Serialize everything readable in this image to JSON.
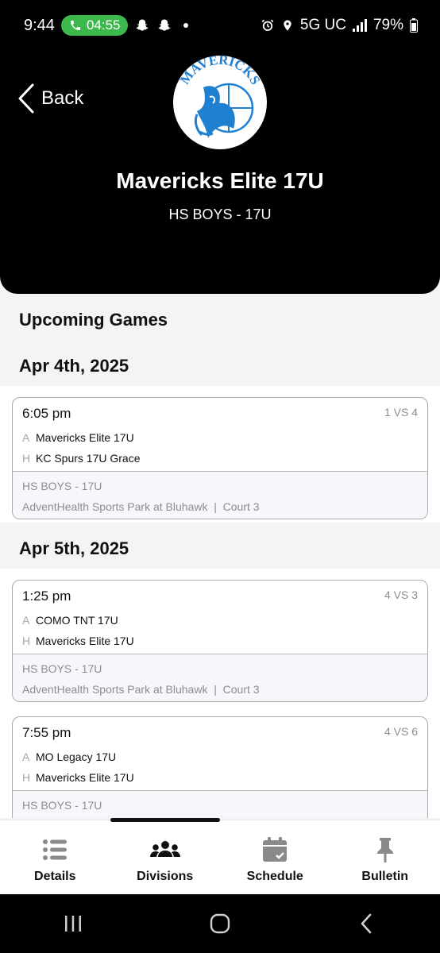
{
  "status_bar": {
    "time": "9:44",
    "call_timer": "04:55",
    "network": "5G UC",
    "battery": "79%"
  },
  "header": {
    "back_label": "Back",
    "logo_text": "MAVERICKS",
    "team_name": "Mavericks Elite 17U",
    "division": "HS BOYS - 17U"
  },
  "main": {
    "section_title": "Upcoming Games",
    "dates": [
      {
        "label": "Apr 4th, 2025"
      },
      {
        "label": "Apr 5th, 2025"
      }
    ],
    "games": [
      {
        "time": "6:05 pm",
        "matchup": "1 VS 4",
        "away_tag": "A",
        "away_team": "Mavericks Elite 17U",
        "home_tag": "H",
        "home_team": "KC Spurs 17U Grace",
        "division": "HS BOYS - 17U",
        "venue": "AdventHealth Sports Park at Bluhawk  |  Court 3"
      },
      {
        "time": "1:25 pm",
        "matchup": "4 VS 3",
        "away_tag": "A",
        "away_team": "COMO TNT 17U",
        "home_tag": "H",
        "home_team": "Mavericks Elite 17U",
        "division": "HS BOYS - 17U",
        "venue": "AdventHealth Sports Park at Bluhawk  |  Court 3"
      },
      {
        "time": "7:55 pm",
        "matchup": "4 VS 6",
        "away_tag": "A",
        "away_team": "MO Legacy 17U",
        "home_tag": "H",
        "home_team": "Mavericks Elite 17U",
        "division": "HS BOYS - 17U",
        "venue": ""
      }
    ]
  },
  "tabs": [
    {
      "label": "Details",
      "icon": "list-icon"
    },
    {
      "label": "Divisions",
      "icon": "users-icon"
    },
    {
      "label": "Schedule",
      "icon": "calendar-check-icon"
    },
    {
      "label": "Bulletin",
      "icon": "pin-icon"
    }
  ],
  "colors": {
    "accent_green": "#3cb94d",
    "logo_blue": "#1f7fd0",
    "tab_active": "#111111",
    "tab_inactive": "#8a8a8a"
  }
}
